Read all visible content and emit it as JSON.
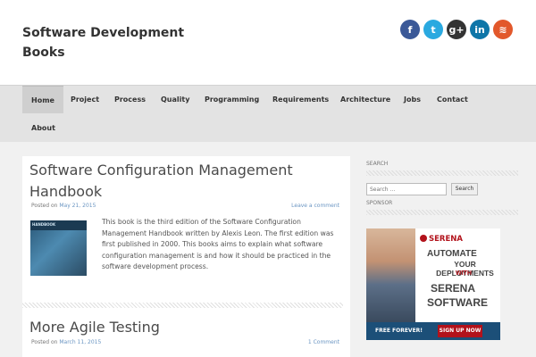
{
  "site": {
    "title": "Software Development Books"
  },
  "social": [
    {
      "icon": "facebook-icon",
      "glyph": "f",
      "color": "#3b5998"
    },
    {
      "icon": "twitter-icon",
      "glyph": "t",
      "color": "#2aa9e0"
    },
    {
      "icon": "google-plus-icon",
      "glyph": "g+",
      "color": "#333333"
    },
    {
      "icon": "linkedin-icon",
      "glyph": "in",
      "color": "#0e76a8"
    },
    {
      "icon": "rss-icon",
      "glyph": "≋",
      "color": "#e2582b"
    }
  ],
  "nav": {
    "items": [
      "Home",
      "Project",
      "Process",
      "Quality",
      "Programming",
      "Requirements",
      "Architecture",
      "Jobs",
      "Contact",
      "About"
    ],
    "active": "Home"
  },
  "posts": [
    {
      "title_line1": "Software Configuration Management",
      "title_line2": "Handbook",
      "posted_on": "Posted on",
      "date": "May 21, 2015",
      "comments": "Leave a comment",
      "thumb_text": "HANDBOOK",
      "excerpt": "This book is the third edition of the Software Configuration Management Handbook written by Alexis Leon. The first edition was first published in 2000. This books aims to explain what software configuration management is and how it should be practiced in the software development process."
    },
    {
      "title_line1": "More Agile Testing",
      "posted_on": "Posted on",
      "date": "March 11, 2015",
      "comments": "1 Comment"
    }
  ],
  "sidebar": {
    "search_title": "SEARCH",
    "search_placeholder": "Search ...",
    "search_button": "Search",
    "sponsor_title": "SPONSOR"
  },
  "ad": {
    "logo": "SERENA",
    "line1": "AUTOMATE",
    "line2": "YOUR DEPLOYMENTS",
    "line3": "WITH",
    "line4": "SERENA",
    "line5": "SOFTWARE",
    "free": "FREE FOREVER!",
    "signup": "SIGN UP NOW"
  }
}
